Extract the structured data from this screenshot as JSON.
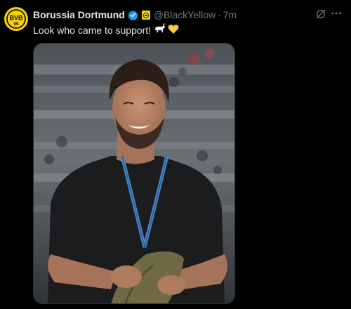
{
  "tweet": {
    "author_name": "Borussia Dortmund",
    "handle": "@BlackYellow",
    "separator": "·",
    "time": "7m",
    "text": "Look who came to support!",
    "emojis": [
      "goat-emoji",
      "yellow-heart-emoji"
    ],
    "avatar_logo_text": "BVB",
    "avatar_logo_year": "09"
  },
  "colors": {
    "background": "#000000",
    "text": "#e7e9ea",
    "muted": "#71767b",
    "verified": "#1d9bf0",
    "brand_yellow": "#f6d300"
  },
  "icons": {
    "verified": "verified-badge-icon",
    "affiliate": "affiliate-badge-icon",
    "grok": "grok-icon",
    "more": "more-icon"
  }
}
